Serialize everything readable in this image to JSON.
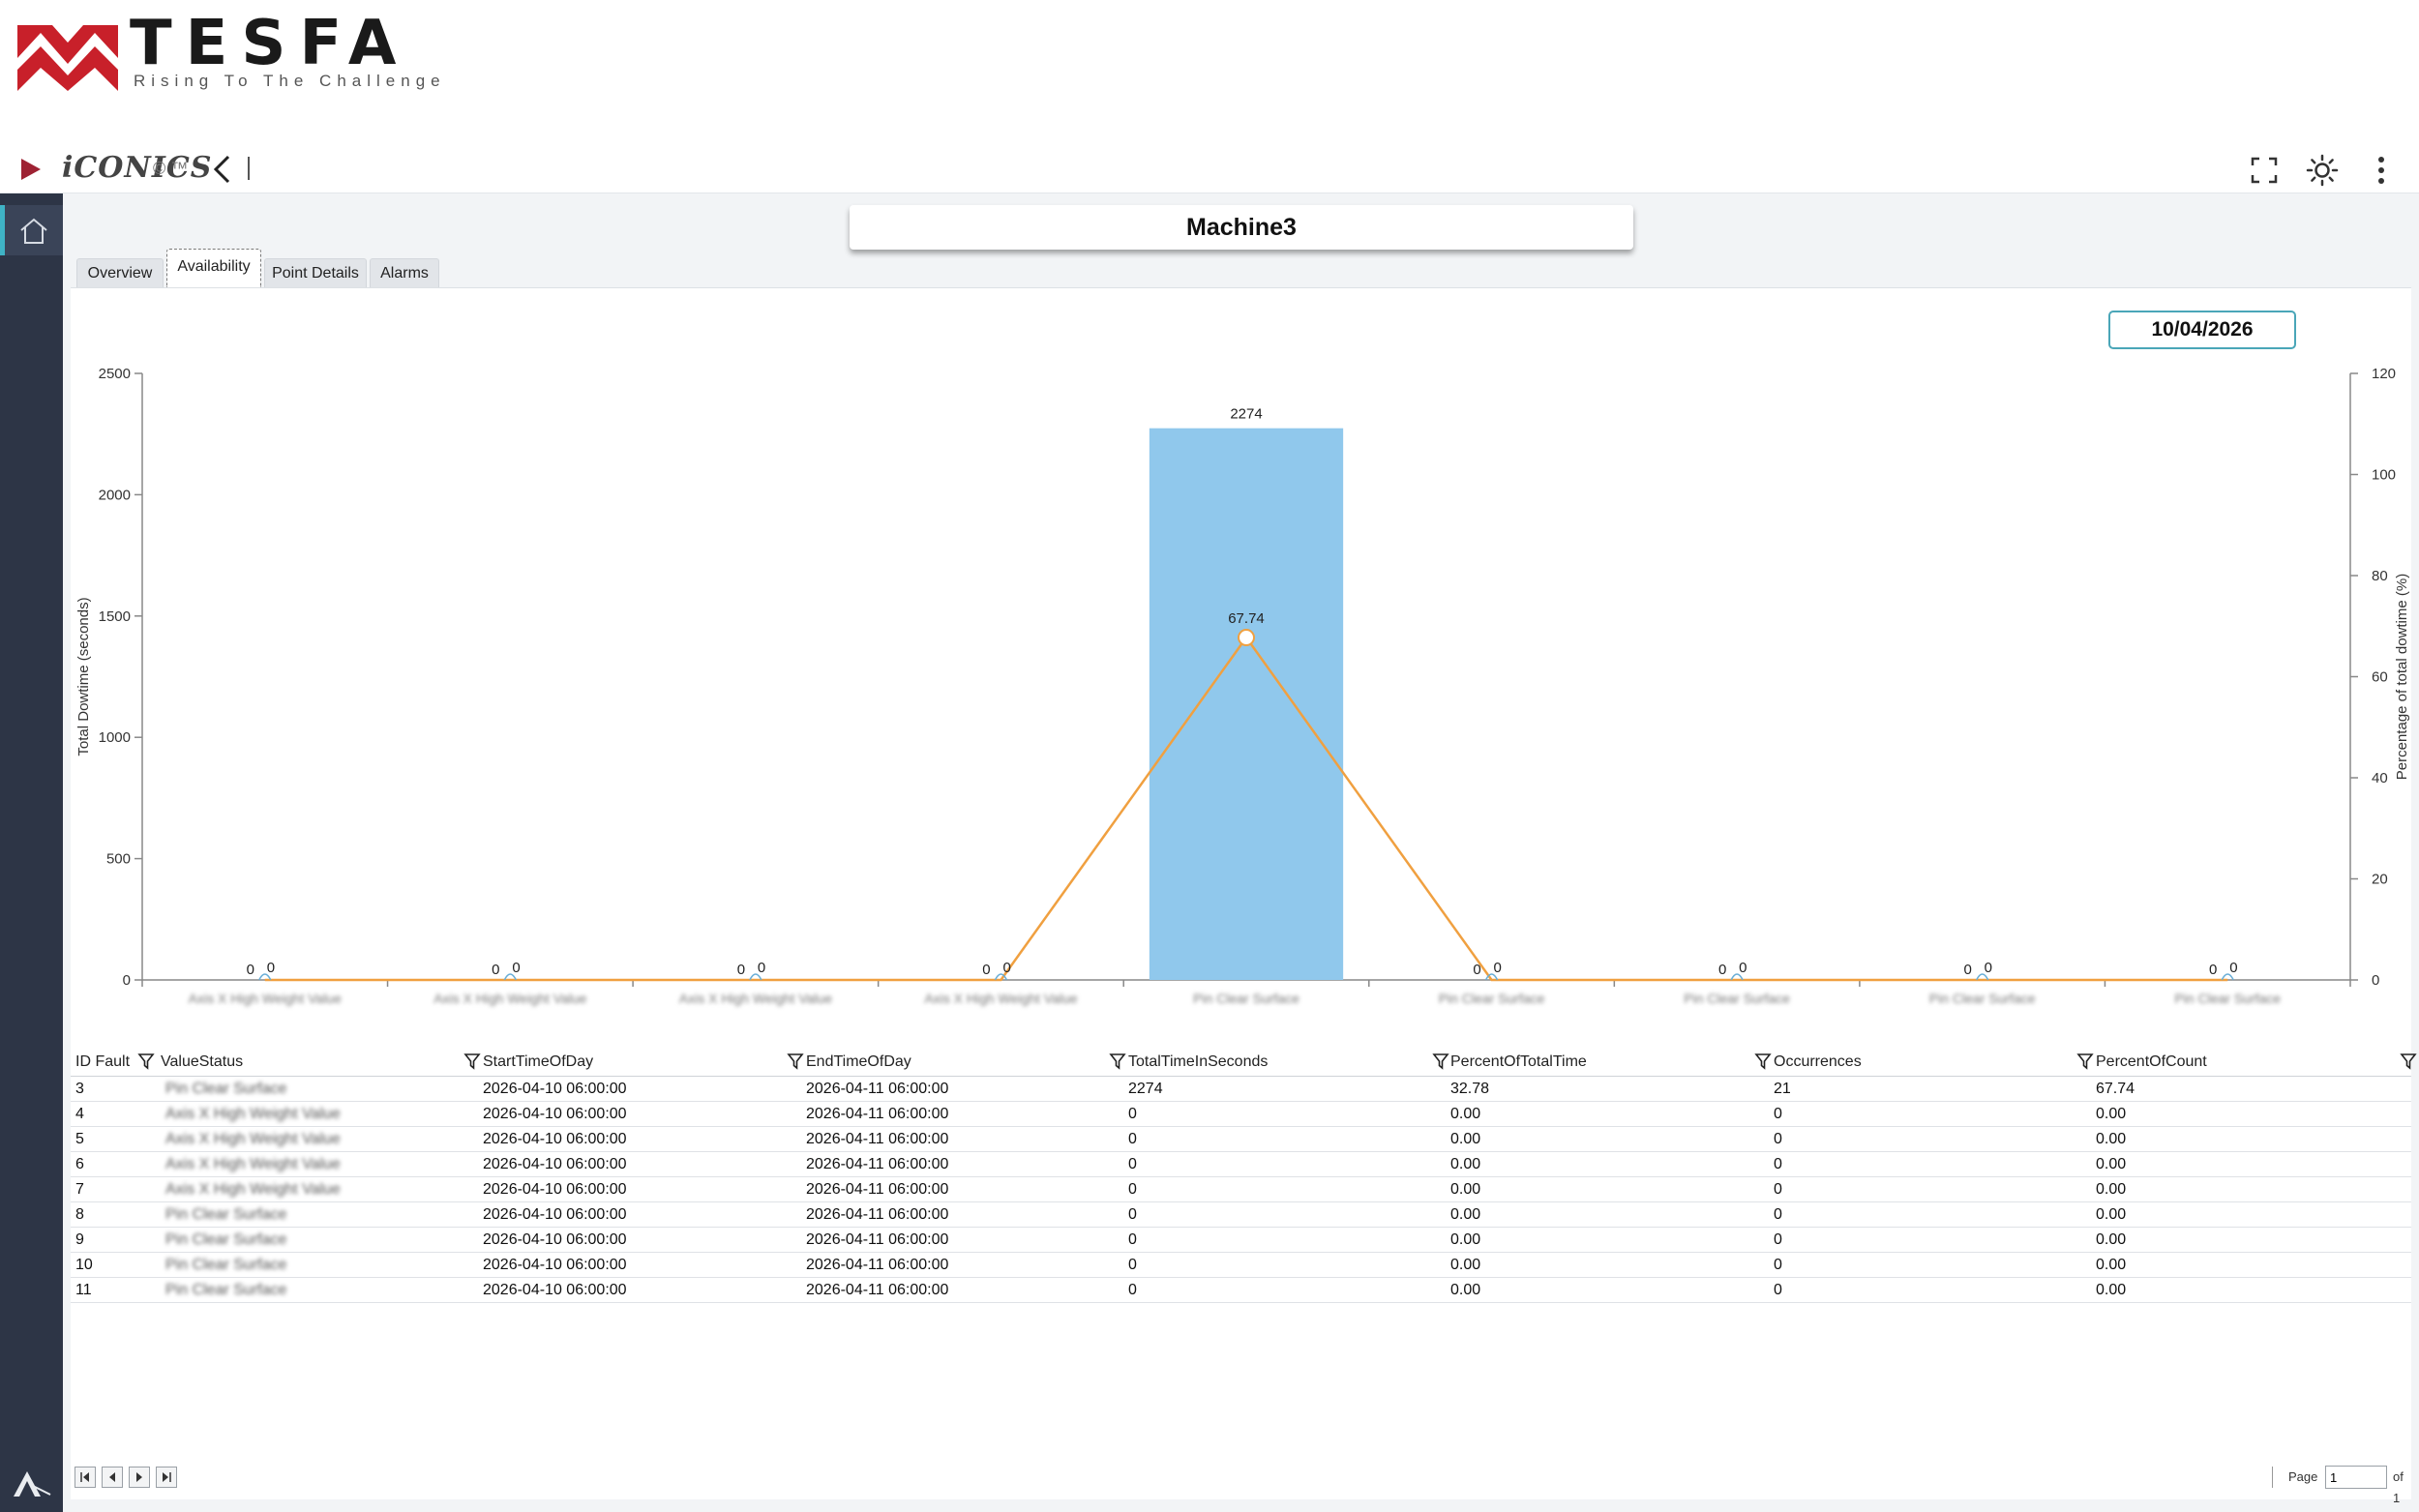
{
  "brand": {
    "name": "TESFA",
    "tagline": "Rising To The Challenge"
  },
  "toolbar": {
    "product": "iCONICS",
    "copyright": "© ™"
  },
  "tabs": [
    {
      "label": "Overview",
      "active": false
    },
    {
      "label": "Availability",
      "active": true
    },
    {
      "label": "Point Details",
      "active": false
    },
    {
      "label": "Alarms",
      "active": false
    }
  ],
  "machine_title": "Machine3",
  "date": "10/04/2026",
  "colors": {
    "bar": "#90c8ec",
    "line": "#f0a040",
    "sidebar": "#2d3546",
    "accent": "#3fb3c5",
    "brand_red": "#c8202a"
  },
  "chart_data": {
    "type": "bar",
    "categories": [
      "Axis X High Weight Value",
      "Axis X High Weight Value",
      "Axis X High Weight Value",
      "Axis X High Weight Value",
      "Pin Clear Surface",
      "Pin Clear Surface",
      "Pin Clear Surface",
      "Pin Clear Surface",
      "Pin Clear Surface"
    ],
    "series": [
      {
        "values": [
          0,
          0,
          0,
          0,
          2274,
          0,
          0,
          0,
          0
        ],
        "axis": "left",
        "kind": "bar"
      },
      {
        "values": [
          0,
          0,
          0,
          0,
          67.74,
          0,
          0,
          0,
          0
        ],
        "axis": "right",
        "kind": "line"
      }
    ],
    "ylabel": "Total Dowtime (seconds)",
    "y2label": "Percentage of total dowtime (%)",
    "ylim": [
      0,
      2500
    ],
    "y2lim": [
      0,
      120
    ],
    "yticks": [
      "0",
      "500",
      "1000",
      "1500",
      "2000",
      "2500"
    ],
    "y2ticks": [
      "0",
      "20",
      "40",
      "60",
      "80",
      "100",
      "120"
    ],
    "grid": false
  },
  "table": {
    "columns": [
      "ID Fault",
      "ValueStatus",
      "StartTimeOfDay",
      "EndTimeOfDay",
      "TotalTimeInSeconds",
      "PercentOfTotalTime",
      "Occurrences",
      "PercentOfCount"
    ],
    "rows": [
      [
        "3",
        "Pin Clear Surface",
        "2026-04-10 06:00:00",
        "2026-04-11 06:00:00",
        "2274",
        "32.78",
        "21",
        "67.74"
      ],
      [
        "4",
        "Axis X High Weight Value",
        "2026-04-10 06:00:00",
        "2026-04-11 06:00:00",
        "0",
        "0.00",
        "0",
        "0.00"
      ],
      [
        "5",
        "Axis X High Weight Value",
        "2026-04-10 06:00:00",
        "2026-04-11 06:00:00",
        "0",
        "0.00",
        "0",
        "0.00"
      ],
      [
        "6",
        "Axis X High Weight Value",
        "2026-04-10 06:00:00",
        "2026-04-11 06:00:00",
        "0",
        "0.00",
        "0",
        "0.00"
      ],
      [
        "7",
        "Axis X High Weight Value",
        "2026-04-10 06:00:00",
        "2026-04-11 06:00:00",
        "0",
        "0.00",
        "0",
        "0.00"
      ],
      [
        "8",
        "Pin Clear Surface",
        "2026-04-10 06:00:00",
        "2026-04-11 06:00:00",
        "0",
        "0.00",
        "0",
        "0.00"
      ],
      [
        "9",
        "Pin Clear Surface",
        "2026-04-10 06:00:00",
        "2026-04-11 06:00:00",
        "0",
        "0.00",
        "0",
        "0.00"
      ],
      [
        "10",
        "Pin Clear Surface",
        "2026-04-10 06:00:00",
        "2026-04-11 06:00:00",
        "0",
        "0.00",
        "0",
        "0.00"
      ],
      [
        "11",
        "Pin Clear Surface",
        "2026-04-10 06:00:00",
        "2026-04-11 06:00:00",
        "0",
        "0.00",
        "0",
        "0.00"
      ]
    ]
  },
  "pager": {
    "page_label": "Page",
    "page_value": "1",
    "of_label": "of 1"
  }
}
